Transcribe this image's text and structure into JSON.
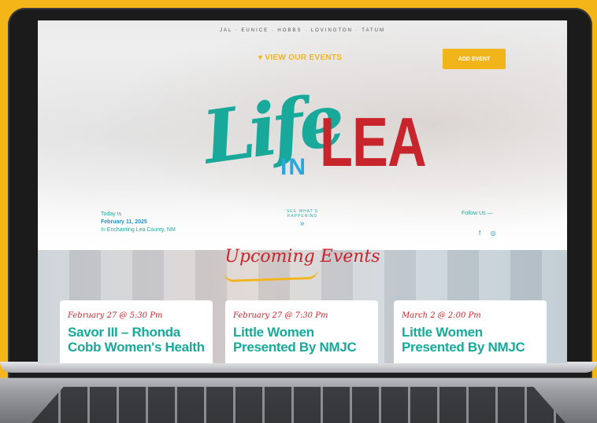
{
  "header": {
    "cities": "JAL · EUNICE · HOBBS · LOVINGTON · TATUM",
    "view_events": "▾ VIEW OUR EVENTS",
    "add_event": "ADD EVENT"
  },
  "logo": {
    "life": "Life",
    "in": "IN",
    "lea": "LEA"
  },
  "info": {
    "today_label": "Today Is",
    "date": "February 11, 2025",
    "location": "In Enchanting Lea County, NM",
    "whats_happening": "SEE WHAT'S HAPPENING",
    "follow": "Follow Us —",
    "facebook": "f",
    "instagram": "◎"
  },
  "events": {
    "heading": "Upcoming Events",
    "cards": [
      {
        "date": "February 27 @ 5:30 Pm",
        "title": "Savor III – Rhonda Cobb Women's Health"
      },
      {
        "date": "February 27 @ 7:30 Pm",
        "title": "Little Women Presented By NMJC"
      },
      {
        "date": "March 2 @ 2:00 Pm",
        "title": "Little Women Presented By NMJC"
      }
    ]
  },
  "colors": {
    "background": "#F4B519",
    "teal": "#18A99A",
    "red": "#C8242C",
    "blue": "#29A8DF",
    "gold": "#F2B41B"
  }
}
